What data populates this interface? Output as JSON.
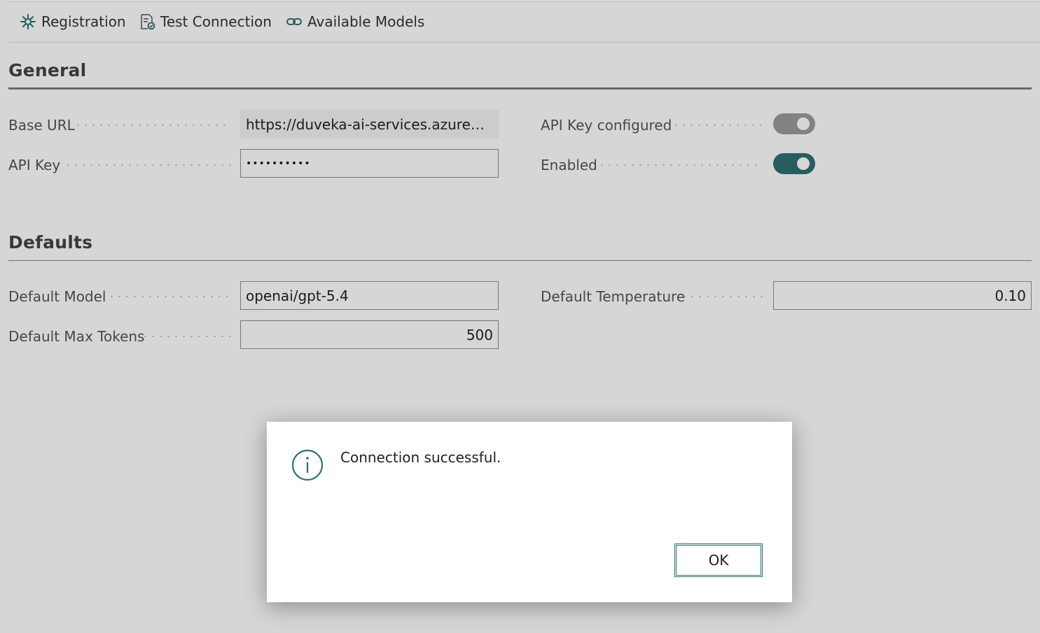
{
  "actions": {
    "registration": {
      "label": "Registration",
      "icon": "gear-icon"
    },
    "test_connection": {
      "label": "Test Connection",
      "icon": "document-check-icon"
    },
    "available_models": {
      "label": "Available Models",
      "icon": "link-icon"
    }
  },
  "general": {
    "title": "General",
    "base_url_label": "Base URL",
    "base_url_value": "https://duveka-ai-services.azureweb...",
    "api_key_label": "API Key",
    "api_key_value": "••••••••••",
    "api_key_configured_label": "API Key configured",
    "api_key_configured": true,
    "enabled_label": "Enabled",
    "enabled": true
  },
  "defaults": {
    "title": "Defaults",
    "default_model_label": "Default Model",
    "default_model_value": "openai/gpt-5.4",
    "default_temperature_label": "Default Temperature",
    "default_temperature_value": "0.10",
    "default_max_tokens_label": "Default Max Tokens",
    "default_max_tokens_value": "500"
  },
  "dialog": {
    "icon": "info-icon",
    "message": "Connection successful.",
    "ok_label": "OK"
  },
  "colors": {
    "accent": "#2f6f73",
    "toggle_off": "#9b9b9b"
  }
}
